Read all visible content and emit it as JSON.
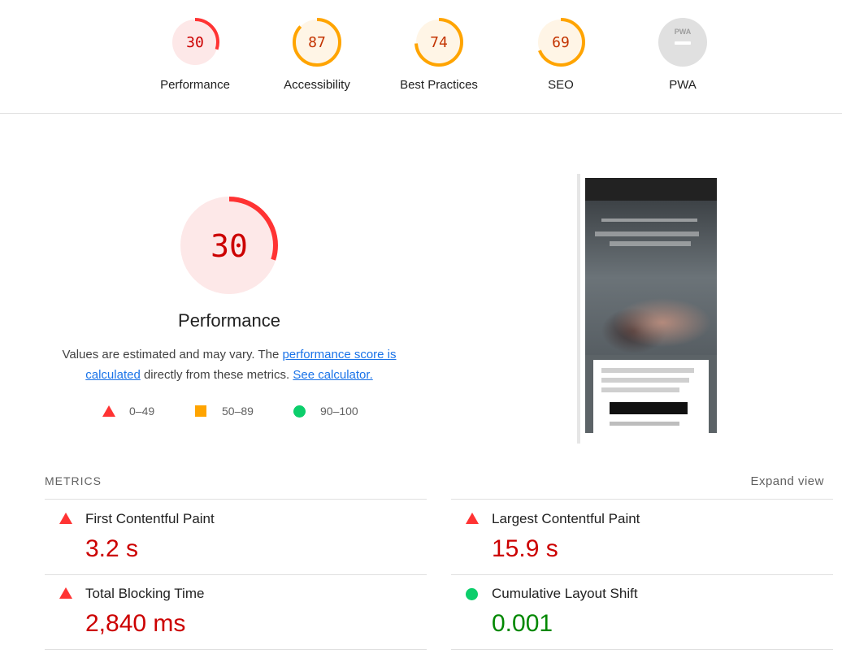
{
  "categories": [
    {
      "label": "Performance",
      "score": "30",
      "fraction": 0.3,
      "color": "#ff3333",
      "bg": "#fde8e8",
      "text_color": "#c00"
    },
    {
      "label": "Accessibility",
      "score": "87",
      "fraction": 0.87,
      "color": "#ffa400",
      "bg": "#fff5e6",
      "text_color": "#c33300"
    },
    {
      "label": "Best Practices",
      "score": "74",
      "fraction": 0.74,
      "color": "#ffa400",
      "bg": "#fff5e6",
      "text_color": "#c33300"
    },
    {
      "label": "SEO",
      "score": "69",
      "fraction": 0.69,
      "color": "#ffa400",
      "bg": "#fff5e6",
      "text_color": "#c33300"
    },
    {
      "label": "PWA",
      "badge": "PWA",
      "color": "#9e9e9e",
      "bg": "#e0e0e0"
    }
  ],
  "performance": {
    "score": "30",
    "fraction": 0.3,
    "title": "Performance",
    "desc_prefix": "Values are estimated and may vary. The ",
    "score_link": "performance score is calculated",
    "desc_middle": " directly from these metrics. ",
    "calc_link": "See calculator."
  },
  "legend": [
    {
      "range": "0–49",
      "shape": "triangle",
      "color": "#ff3333"
    },
    {
      "range": "50–89",
      "shape": "square",
      "color": "#ffa400"
    },
    {
      "range": "90–100",
      "shape": "circle",
      "color": "#0cce6b"
    }
  ],
  "metrics_section": {
    "title": "METRICS",
    "expand_label": "Expand view",
    "items": [
      {
        "name": "First Contentful Paint",
        "value": "3.2 s",
        "status": "fail"
      },
      {
        "name": "Largest Contentful Paint",
        "value": "15.9 s",
        "status": "fail"
      },
      {
        "name": "Total Blocking Time",
        "value": "2,840 ms",
        "status": "fail"
      },
      {
        "name": "Cumulative Layout Shift",
        "value": "0.001",
        "status": "pass"
      }
    ]
  }
}
